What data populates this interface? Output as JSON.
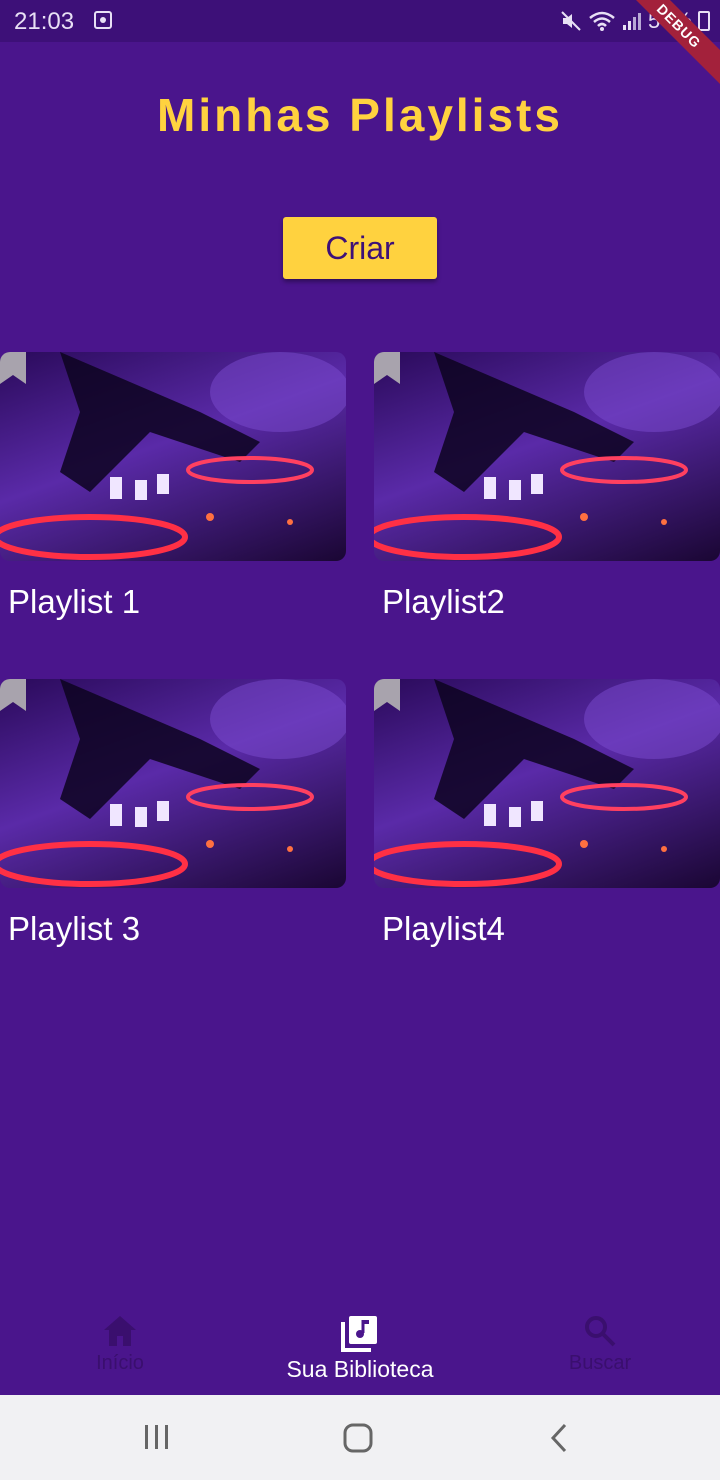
{
  "status_bar": {
    "time": "21:03",
    "battery": "56%"
  },
  "debug_banner": "DEBUG",
  "page": {
    "title": "Minhas Playlists",
    "create_label": "Criar"
  },
  "playlists": [
    {
      "title": "Playlist 1"
    },
    {
      "title": "Playlist2"
    },
    {
      "title": "Playlist 3"
    },
    {
      "title": "Playlist4"
    }
  ],
  "bottom_nav": {
    "items": [
      {
        "label": "Início",
        "icon": "home-icon",
        "active": false
      },
      {
        "label": "Sua Biblioteca",
        "icon": "library-music-icon",
        "active": true
      },
      {
        "label": "Buscar",
        "icon": "search-icon",
        "active": false
      }
    ]
  },
  "colors": {
    "background": "#4a158c",
    "accent": "#ffd23f",
    "nav_inactive": "#3a0f6e",
    "system_nav": "#f1f1f3"
  }
}
